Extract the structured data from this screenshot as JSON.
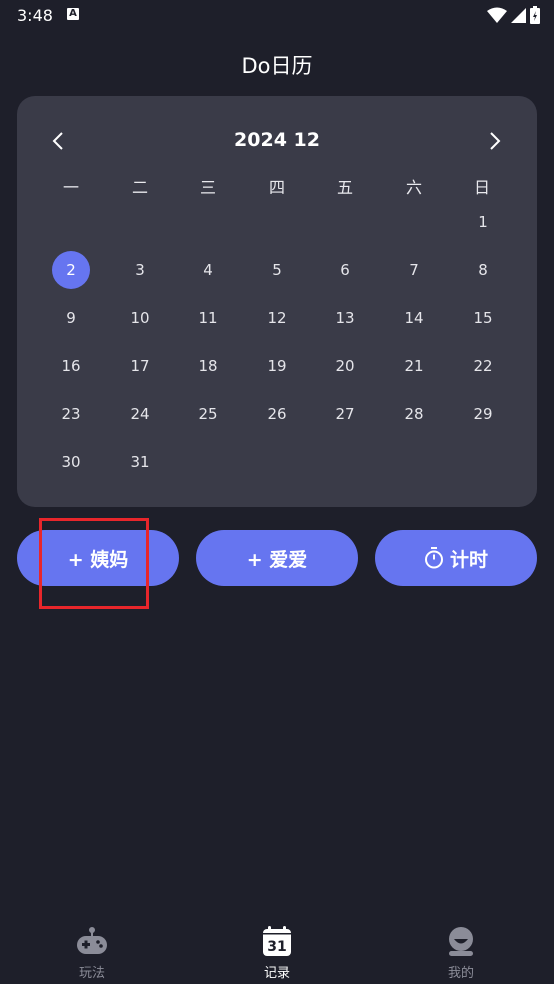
{
  "status_bar": {
    "time": "3:48",
    "notification_glyph": "A"
  },
  "app": {
    "title": "Do日历"
  },
  "calendar": {
    "month_title": "2024 12",
    "weekdays": [
      "一",
      "二",
      "三",
      "四",
      "五",
      "六",
      "日"
    ],
    "days": [
      "1",
      "2",
      "3",
      "4",
      "5",
      "6",
      "7",
      "8",
      "9",
      "10",
      "11",
      "12",
      "13",
      "14",
      "15",
      "16",
      "17",
      "18",
      "19",
      "20",
      "21",
      "22",
      "23",
      "24",
      "25",
      "26",
      "27",
      "28",
      "29",
      "30",
      "31"
    ],
    "selected_day": "2"
  },
  "actions": {
    "period_label": "+ 姨妈",
    "love_label": "+ 爱爱",
    "timer_label": "计时"
  },
  "tab_bar": {
    "play_label": "玩法",
    "record_label": "记录",
    "record_icon_text": "31",
    "mine_label": "我的",
    "active_tab": "记录"
  },
  "colors": {
    "background": "#1e1f2a",
    "card": "#3a3b48",
    "accent": "#6675f0",
    "highlight": "#e8262b",
    "inactive_tab": "#8b8c98"
  },
  "icons": {
    "prev": "chevron-left-icon",
    "next": "chevron-right-icon",
    "timer": "stopwatch-icon",
    "play": "gamepad-icon",
    "record": "calendar-icon",
    "mine": "user-icon"
  }
}
